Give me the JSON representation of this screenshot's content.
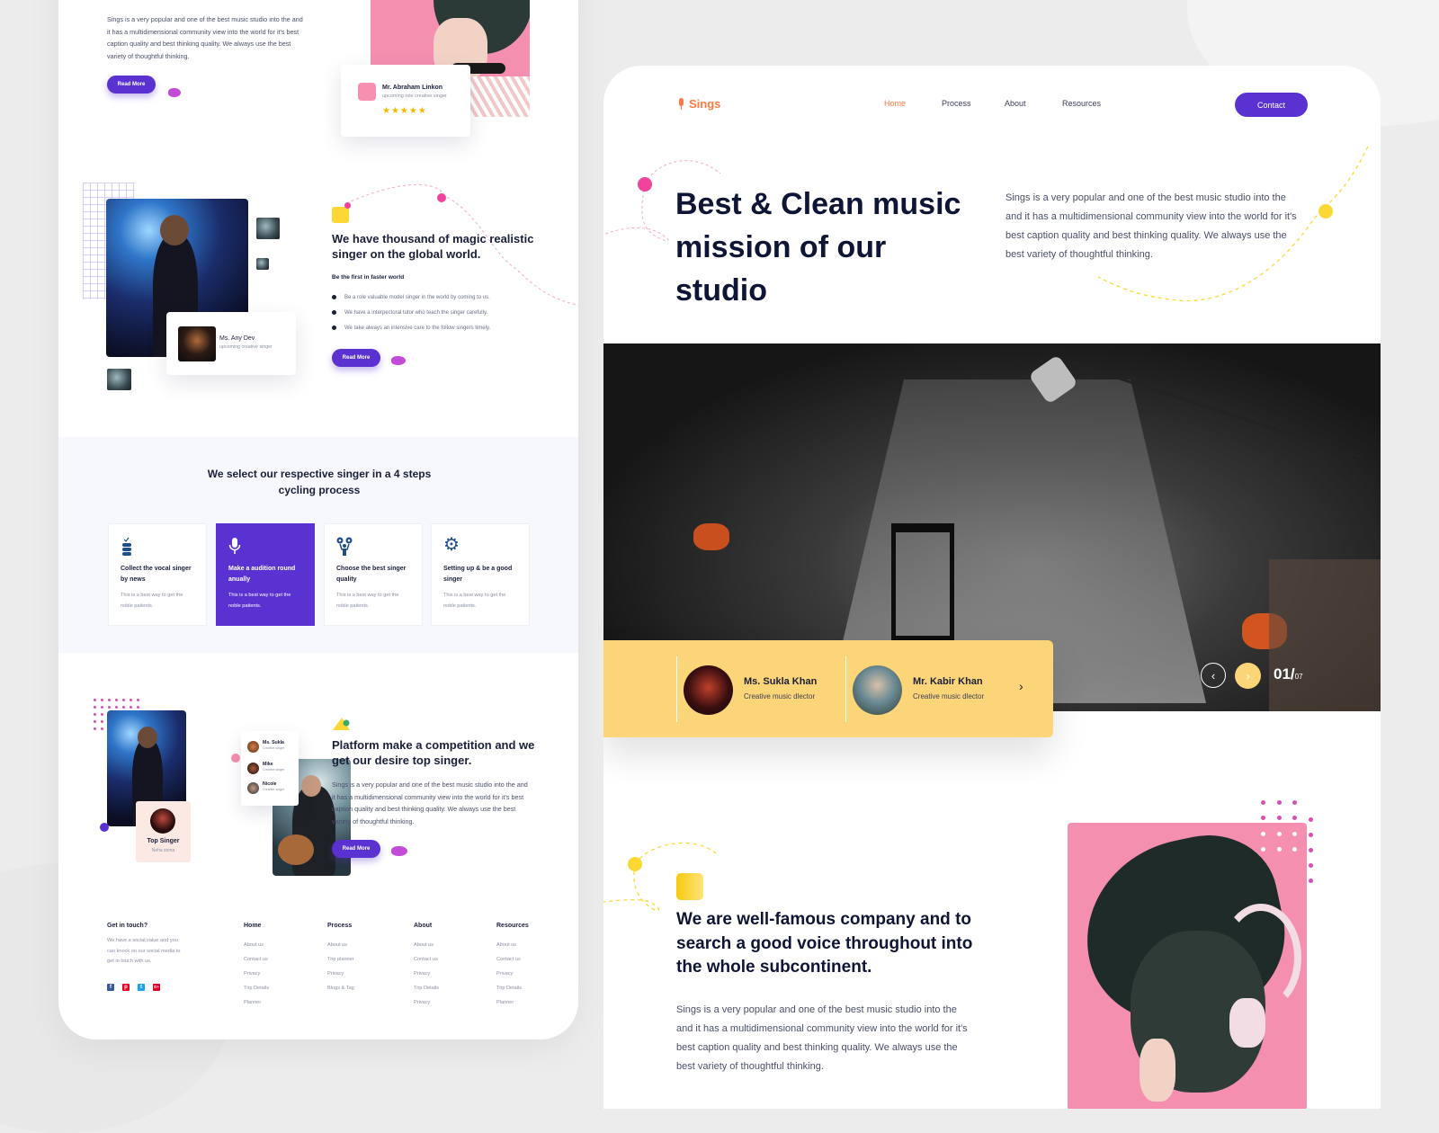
{
  "left_page": {
    "intro": {
      "body": "Sings is a very popular and one of the best music studio into the and it has a multidimensional community view into the world for it's best caption quality and best thinking quality. We always use the best variety of thoughtful thinking.",
      "read_more": "Read More",
      "testimonial": {
        "name": "Mr. Abraham Linkon",
        "role": "upcoming role creative singer",
        "rating": 5,
        "stars": "★★★★★"
      }
    },
    "singers": {
      "heading": "We have thousand of magic realistic singer on the global world.",
      "subheading": "Be the first in faster world",
      "bullets": [
        "Be a role valuable model singer in the world by coming to us.",
        "We have a interpectoral tutor who teach the singer carefully.",
        "We take always an intensive care to the follow singers timely."
      ],
      "read_more": "Read More",
      "profile": {
        "name": "Ms. Any Dev",
        "role": "upcoming creative singer"
      }
    },
    "process": {
      "heading": "We select our respective singer in a 4 steps cycling process",
      "steps": [
        {
          "icon": "database-icon",
          "title": "Collect the vocal singer by news",
          "desc": "This is a best way to get the noble patients.",
          "active": false
        },
        {
          "icon": "microphone-icon",
          "title": "Make a audition round anually",
          "desc": "This is a best way to get the noble patients.",
          "active": true
        },
        {
          "icon": "people-choice-icon",
          "title": "Choose the best singer quality",
          "desc": "This is a best way to get the noble patients.",
          "active": false
        },
        {
          "icon": "gear-icon",
          "title": "Setting up & be a good singer",
          "desc": "This is a best way to get the noble patients.",
          "active": false
        }
      ]
    },
    "competition": {
      "heading": "Platform make a competition and we get our desire top singer.",
      "body": "Sings is a very popular and one of the best music studio into the and it has a multidimensional community view into the world for it's best caption quality and best thinking quality. We always use the best variety of thoughtful thinking.",
      "read_more": "Read More",
      "singer_list": [
        {
          "name": "Ms. Sukla",
          "role": "Creative singer"
        },
        {
          "name": "Mike",
          "role": "Creative singer"
        },
        {
          "name": "Nicole",
          "role": "Creative singer"
        }
      ],
      "top_singer": {
        "label": "Top Singer",
        "name": "Neha soma"
      }
    },
    "footer": {
      "contact": {
        "title": "Get in touch?",
        "body": "We have a social value and you can knock on our social media to get in touch with us.",
        "social": [
          {
            "icon": "facebook-icon",
            "glyph": "f",
            "color": "#3b5998"
          },
          {
            "icon": "pinterest-icon",
            "glyph": "p",
            "color": "#e60023"
          },
          {
            "icon": "twitter-icon",
            "glyph": "t",
            "color": "#1da1f2"
          },
          {
            "icon": "google-plus-icon",
            "glyph": "G+",
            "color": "#e4002b"
          }
        ]
      },
      "columns": [
        {
          "title": "Home",
          "links": [
            "About us",
            "Contact us",
            "Privacy",
            "Trip Details",
            "Planner"
          ]
        },
        {
          "title": "Process",
          "links": [
            "About us",
            "Trip planner",
            "Privacy",
            "Blogs & Tag"
          ]
        },
        {
          "title": "About",
          "links": [
            "About us",
            "Contact us",
            "Privacy",
            "Trip Details",
            "Privacy"
          ]
        },
        {
          "title": "Resources",
          "links": [
            "About us",
            "Contact us",
            "Privacy",
            "Trip Details",
            "Planner"
          ]
        }
      ]
    }
  },
  "right_page": {
    "brand": "Sings",
    "nav": [
      "Home",
      "Process",
      "About",
      "Resources"
    ],
    "nav_active": "Home",
    "contact_button": "Contact",
    "hero": {
      "title": "Best & Clean music mission of our studio",
      "body": "Sings is a very popular and one of the best music studio into the and it has a multidimensional community view into the world for it's best caption quality and best thinking quality. We always use the best variety of thoughtful thinking."
    },
    "directors": [
      {
        "name": "Ms. Sukla Khan",
        "role": "Creative music dlector"
      },
      {
        "name": "Mr. Kabir Khan",
        "role": "Creative music dlector"
      }
    ],
    "slider": {
      "current": "01/",
      "total": "07"
    },
    "about": {
      "heading": "We are well-famous company and to search a good voice throughout into the whole subcontinent.",
      "body": "Sings is a very popular and one of the best music studio into the and it has a multidimensional community view into the world for it's best caption quality and best thinking quality. We always use the best variety of thoughtful thinking."
    }
  },
  "colors": {
    "accent_purple": "#5a32d1",
    "accent_orange": "#ff7a45",
    "accent_yellow": "#fbd577",
    "accent_pink": "#f0449c",
    "text_dark": "#0f1535"
  }
}
